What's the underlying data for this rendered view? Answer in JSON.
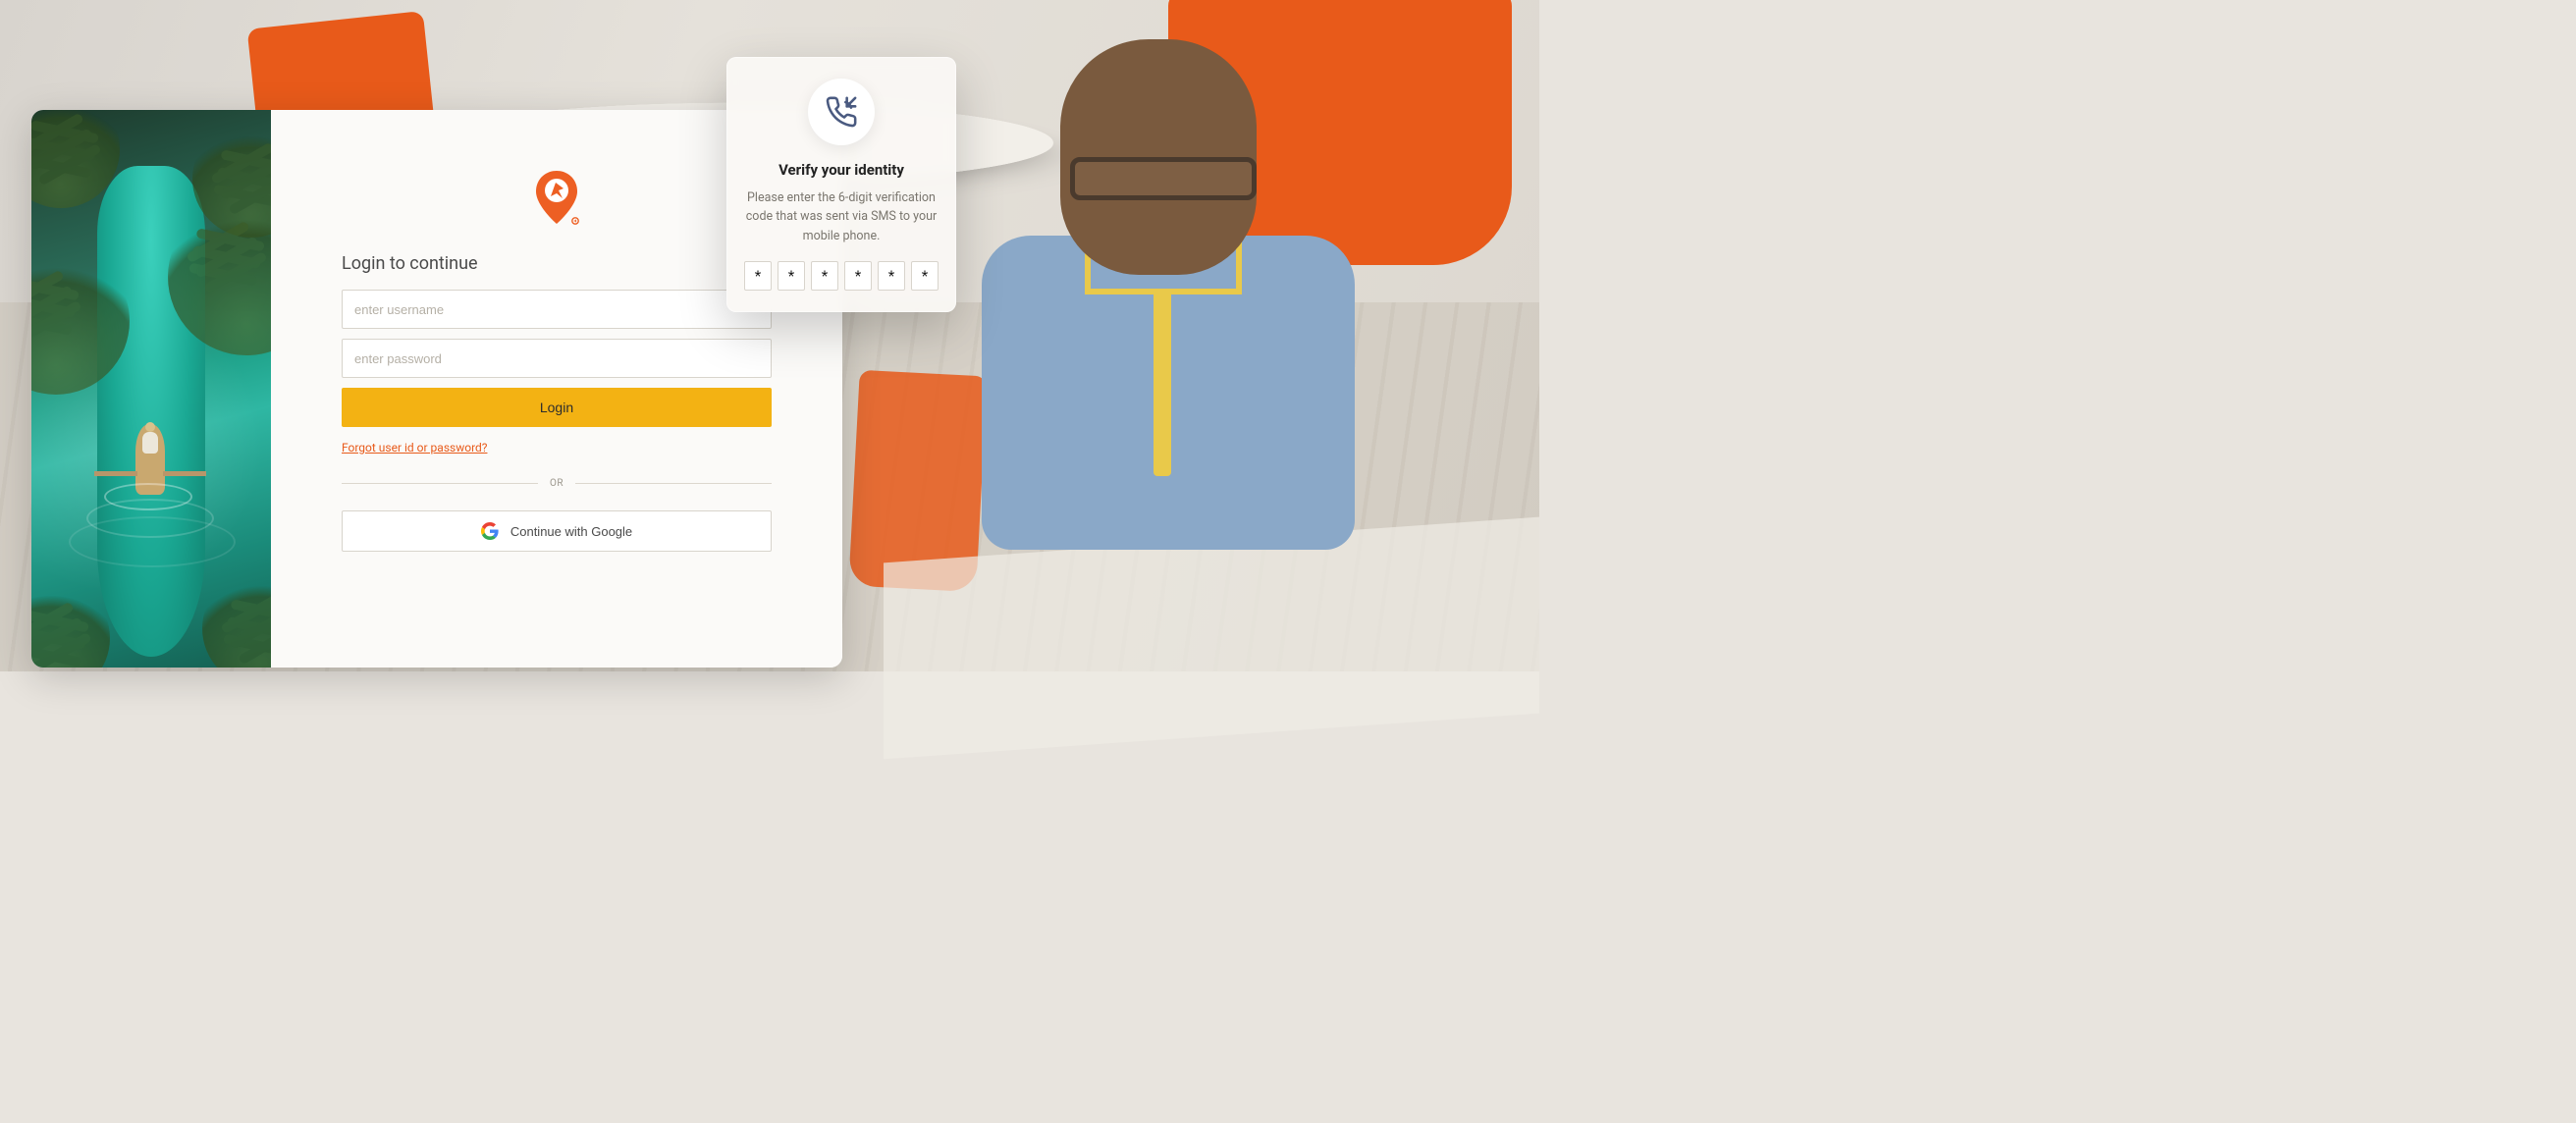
{
  "login": {
    "title": "Login to continue",
    "username_placeholder": "enter username",
    "username_value": "",
    "password_placeholder": "enter password",
    "password_value": "",
    "submit_label": "Login",
    "forgot_label": "Forgot user id or password?",
    "divider_label": "OR",
    "google_label": "Continue with Google"
  },
  "verify": {
    "title": "Verify your identity",
    "description": "Please enter the 6-digit verification code that was sent via SMS to your mobile phone.",
    "code": [
      "*",
      "*",
      "*",
      "*",
      "*",
      "*"
    ]
  },
  "brand": {
    "accent_color": "#ed5f23",
    "action_color": "#f3b213"
  }
}
